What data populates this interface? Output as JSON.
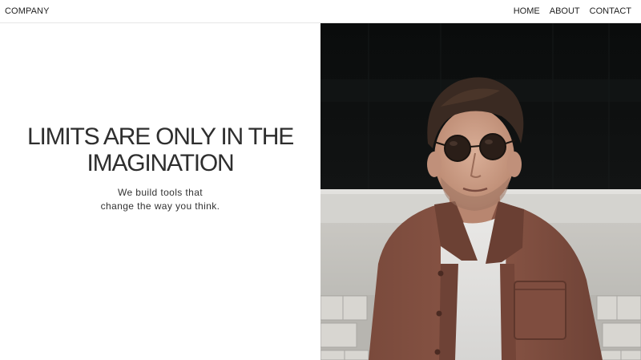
{
  "header": {
    "brand": "COMPANY",
    "nav": [
      {
        "label": "HOME"
      },
      {
        "label": "ABOUT"
      },
      {
        "label": "CONTACT"
      }
    ]
  },
  "hero": {
    "headline": "LIMITS ARE ONLY IN THE IMAGINATION",
    "tagline_line1": "We build tools that",
    "tagline_line2": "change the way you think."
  },
  "colors": {
    "text": "#2e2e2e",
    "background": "#ffffff",
    "divider": "#e6e6e6"
  }
}
